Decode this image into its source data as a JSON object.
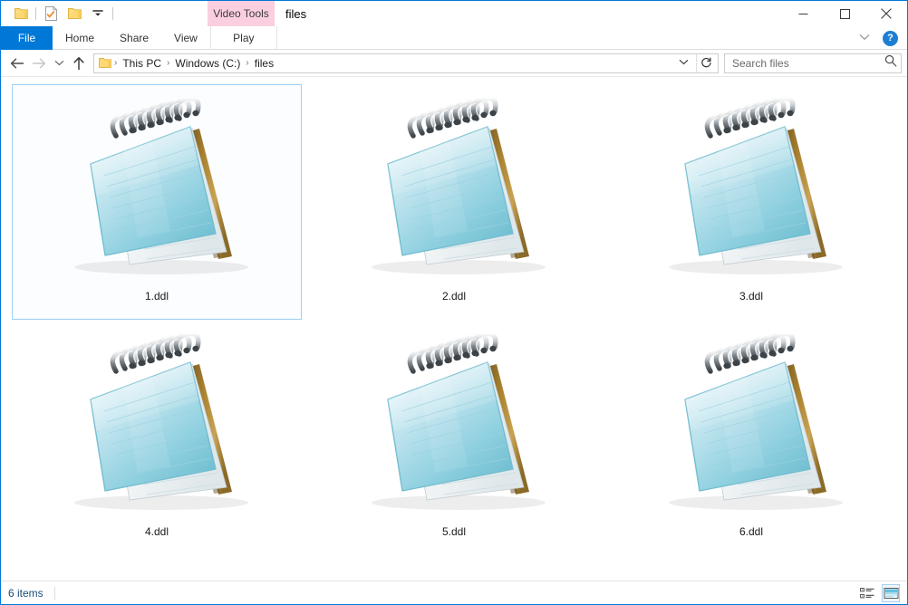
{
  "window": {
    "title": "files",
    "contextual_tab_group": "Video Tools",
    "accent_color": "#0078d7",
    "contextual_tab_color": "#fbcfe0"
  },
  "quick_access_toolbar": {
    "items": [
      {
        "name": "explorer-menu-icon",
        "label": "Explorer menu"
      },
      {
        "name": "properties-icon",
        "label": "Properties"
      },
      {
        "name": "new-folder-icon",
        "label": "New folder"
      },
      {
        "name": "customize-qat-icon",
        "label": "Customize Quick Access Toolbar"
      }
    ]
  },
  "window_controls": {
    "minimize": "─",
    "maximize": "☐",
    "close": "✕"
  },
  "ribbon": {
    "tabs": [
      {
        "label": "File",
        "active": true
      },
      {
        "label": "Home",
        "active": false
      },
      {
        "label": "Share",
        "active": false
      },
      {
        "label": "View",
        "active": false
      },
      {
        "label": "Play",
        "active": false
      }
    ],
    "collapse_label": "∨",
    "help_label": "?"
  },
  "address_bar": {
    "back_label": "←",
    "forward_label": "→",
    "recent_label": "∨",
    "up_label": "↑",
    "breadcrumbs": [
      "This PC",
      "Windows (C:)",
      "files"
    ],
    "separator": "›",
    "dropdown_label": "∨",
    "refresh_label": "↻"
  },
  "search": {
    "placeholder": "Search files",
    "value": "",
    "icon": "search-icon"
  },
  "files": [
    {
      "name": "1.ddl",
      "type": "text-document",
      "selected": true
    },
    {
      "name": "2.ddl",
      "type": "text-document",
      "selected": false
    },
    {
      "name": "3.ddl",
      "type": "text-document",
      "selected": false
    },
    {
      "name": "4.ddl",
      "type": "text-document",
      "selected": false
    },
    {
      "name": "5.ddl",
      "type": "text-document",
      "selected": false
    },
    {
      "name": "6.ddl",
      "type": "text-document",
      "selected": false
    }
  ],
  "status_bar": {
    "item_count_text": "6 items",
    "views": [
      {
        "name": "details-view",
        "active": false
      },
      {
        "name": "large-icons-view",
        "active": true
      }
    ]
  }
}
